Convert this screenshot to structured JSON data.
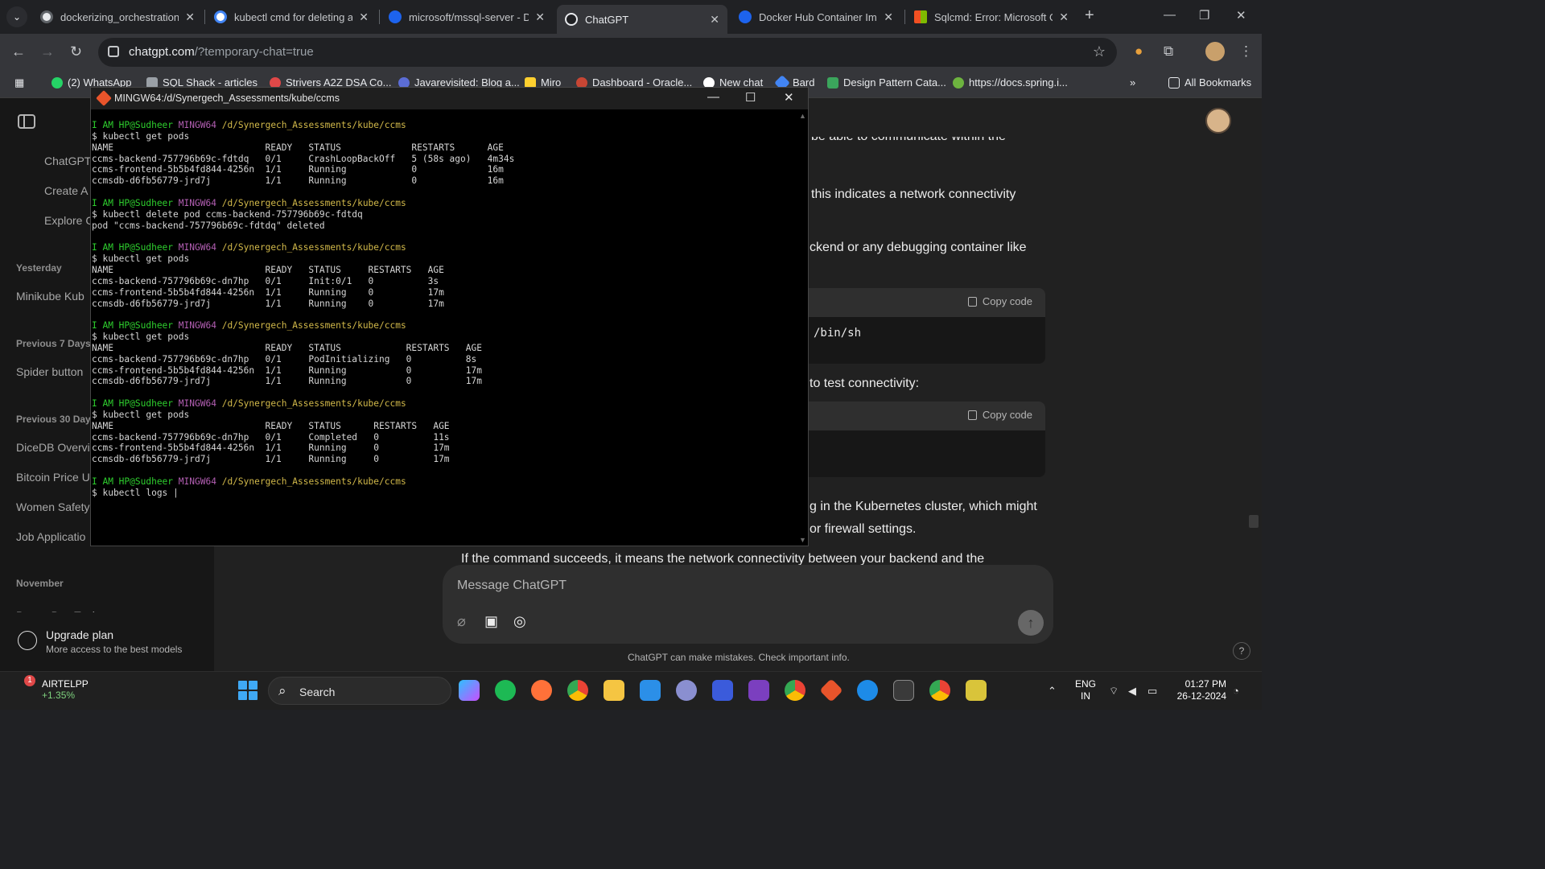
{
  "browser": {
    "tabs": [
      {
        "title": "dockerizing_orchestration.p",
        "favicon_color": "#1f1f1f"
      },
      {
        "title": "kubectl cmd for deleting a",
        "favicon_color": "#4285f4"
      },
      {
        "title": "microsoft/mssql-server - D",
        "favicon_color": "#1d63ed"
      },
      {
        "title": "ChatGPT",
        "favicon_color": "#ffffff",
        "active": true
      },
      {
        "title": "Docker Hub Container Ima",
        "favicon_color": "#1d63ed"
      },
      {
        "title": "Sqlcmd: Error: Microsoft O",
        "favicon_color": "#f25022"
      }
    ],
    "url_host": "chatgpt.com",
    "url_path": "/?temporary-chat=true",
    "bookmarks": [
      {
        "label": "(2) WhatsApp",
        "color": "#25d366"
      },
      {
        "label": "SQL Shack - articles",
        "color": "#9aa0a6"
      },
      {
        "label": "Strivers A2Z DSA Co...",
        "color": "#e04848"
      },
      {
        "label": "Javarevisited: Blog a...",
        "color": "#5b6dd6"
      },
      {
        "label": "Miro",
        "color": "#ffd02f"
      },
      {
        "label": "Dashboard - Oracle...",
        "color": "#c74634"
      },
      {
        "label": "New chat",
        "color": "#ffffff"
      },
      {
        "label": "Bard",
        "color": "#4285f4"
      },
      {
        "label": "Design Pattern Cata...",
        "color": "#3ba55c"
      },
      {
        "label": "https://docs.spring.i...",
        "color": "#6db33f"
      }
    ],
    "all_bookmarks": "All Bookmarks"
  },
  "chatgpt": {
    "sidebar": {
      "items_top": [
        "ChatGPT",
        "Create A",
        "Explore G"
      ],
      "sections": [
        {
          "heading": "Yesterday",
          "items": [
            "Minikube Kub"
          ]
        },
        {
          "heading": "Previous 7 Days",
          "items": [
            "Spider button"
          ]
        },
        {
          "heading": "Previous 30 Days",
          "items": [
            "DiceDB Overvi",
            "Bitcoin Price U",
            "Women Safety",
            "Job Applicatio"
          ]
        },
        {
          "heading": "November",
          "items": [
            "Brown Bag Topics"
          ]
        }
      ],
      "upgrade_title": "Upgrade plan",
      "upgrade_sub": "More access to the best models"
    },
    "content": {
      "line_top": "be able to communicate within the",
      "line1": "this indicates a network connectivity",
      "line2": "ckend or any debugging container like",
      "code1": "/bin/sh",
      "copy_label": "Copy code",
      "line3": "to test connectivity:",
      "line4": "g in the Kubernetes cluster, which might",
      "line5": "or firewall settings.",
      "line6": "If the command succeeds, it means the network connectivity between your backend and the"
    },
    "composer_placeholder": "Message ChatGPT",
    "disclaimer": "ChatGPT can make mistakes. Check important info.",
    "help": "?"
  },
  "terminal": {
    "title": "MINGW64:/d/Synergech_Assessments/kube/ccms",
    "prompt_user": "I AM HP@Sudheer",
    "prompt_env": "MINGW64",
    "prompt_path": "/d/Synergech_Assessments/kube/ccms",
    "blocks": [
      {
        "cmd": "$ kubectl get pods",
        "output": [
          "NAME                            READY   STATUS             RESTARTS      AGE",
          "ccms-backend-757796b69c-fdtdq   0/1     CrashLoopBackOff   5 (58s ago)   4m34s",
          "ccms-frontend-5b5b4fd844-4256n  1/1     Running            0             16m",
          "ccmsdb-d6fb56779-jrd7j          1/1     Running            0             16m"
        ]
      },
      {
        "cmd": "$ kubectl delete pod ccms-backend-757796b69c-fdtdq",
        "output": [
          "pod \"ccms-backend-757796b69c-fdtdq\" deleted"
        ]
      },
      {
        "cmd": "$ kubectl get pods",
        "output": [
          "NAME                            READY   STATUS     RESTARTS   AGE",
          "ccms-backend-757796b69c-dn7hp   0/1     Init:0/1   0          3s",
          "ccms-frontend-5b5b4fd844-4256n  1/1     Running    0          17m",
          "ccmsdb-d6fb56779-jrd7j          1/1     Running    0          17m"
        ]
      },
      {
        "cmd": "$ kubectl get pods",
        "output": [
          "NAME                            READY   STATUS            RESTARTS   AGE",
          "ccms-backend-757796b69c-dn7hp   0/1     PodInitializing   0          8s",
          "ccms-frontend-5b5b4fd844-4256n  1/1     Running           0          17m",
          "ccmsdb-d6fb56779-jrd7j          1/1     Running           0          17m"
        ]
      },
      {
        "cmd": "$ kubectl get pods",
        "output": [
          "NAME                            READY   STATUS      RESTARTS   AGE",
          "ccms-backend-757796b69c-dn7hp   0/1     Completed   0          11s",
          "ccms-frontend-5b5b4fd844-4256n  1/1     Running     0          17m",
          "ccmsdb-d6fb56779-jrd7j          1/1     Running     0          17m"
        ]
      }
    ],
    "current_input": "$ kubectl logs |"
  },
  "taskbar": {
    "stock_name": "AIRTELPP",
    "stock_change": "+1.35%",
    "notification_count": "1",
    "search_label": "Search",
    "lang": "ENG",
    "region": "IN",
    "time": "01:27 PM",
    "date": "26-12-2024"
  }
}
